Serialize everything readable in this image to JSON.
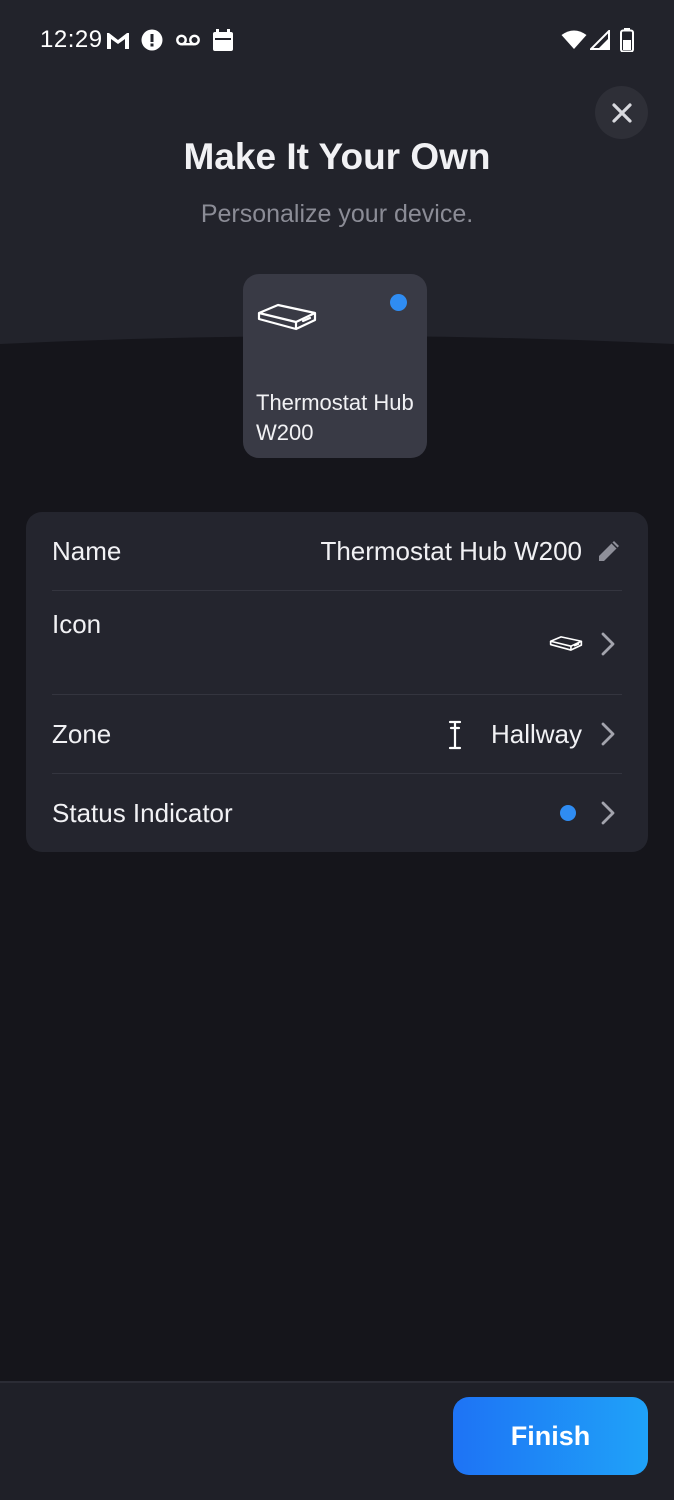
{
  "status_bar": {
    "time": "12:29",
    "icons": [
      "gmail-icon",
      "alert-icon",
      "voicemail-icon",
      "calendar-icon",
      "wifi-icon",
      "signal-icon",
      "battery-icon"
    ]
  },
  "header": {
    "title": "Make It Your Own",
    "subtitle": "Personalize your device.",
    "close_icon": "close-icon"
  },
  "device_preview": {
    "name": "Thermostat Hub W200",
    "icon": "hub-device-icon",
    "status_color": "#2f8cf2"
  },
  "settings": {
    "name": {
      "label": "Name",
      "value": "Thermostat Hub W200",
      "icon": "pencil-icon"
    },
    "icon": {
      "label": "Icon",
      "value_icon": "hub-device-icon"
    },
    "zone": {
      "label": "Zone",
      "value": "Hallway",
      "icon": "zone-pin-icon"
    },
    "status_indicator": {
      "label": "Status Indicator",
      "color": "#2f8cf2"
    }
  },
  "footer": {
    "finish_label": "Finish"
  },
  "colors": {
    "accent": "#1e73f5",
    "background": "#15151b",
    "header_background": "#22232b",
    "card": "#24252e"
  }
}
